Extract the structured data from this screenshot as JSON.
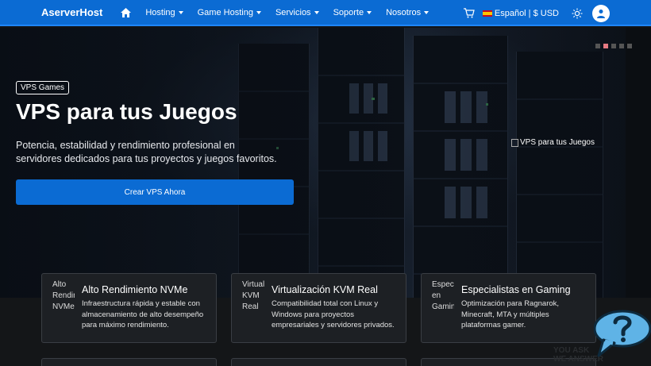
{
  "brand": "AserverHost",
  "nav": {
    "items": [
      {
        "label": "Hosting"
      },
      {
        "label": "Game Hosting"
      },
      {
        "label": "Servicios"
      },
      {
        "label": "Soporte"
      },
      {
        "label": "Nosotros"
      }
    ],
    "lang_label": "Español | $ USD",
    "icons": [
      "home-icon",
      "cart-icon",
      "spain-flag-icon",
      "sun-icon",
      "user-icon"
    ]
  },
  "hero": {
    "badge": "VPS Games",
    "title": "VPS para tus Juegos",
    "subtitle": "Potencia, estabilidad y rendimiento profesional en servidores dedicados para tus proyectos y juegos favoritos.",
    "cta_label": "Crear VPS Ahora",
    "image_alt": "VPS para tus Juegos",
    "slides": 5,
    "active_slide": 2
  },
  "features": [
    {
      "img_alt": "Alto Rendimiento NVMe",
      "title": "Alto Rendimiento NVMe",
      "description": "Infraestructura rápida y estable con almacenamiento de alto desempeño para máximo rendimiento."
    },
    {
      "img_alt": "Virtualización KVM Real",
      "title": "Virtualización KVM Real",
      "description": "Compatibilidad total con Linux y Windows para proyectos empresariales y servidores privados."
    },
    {
      "img_alt": "Especialistas en Gaming",
      "title": "Especialistas en Gaming",
      "description": "Optimización para Ragnarok, Minecraft, MTA y múltiples plataformas gamer."
    }
  ],
  "help": {
    "caption_line1": "YOU ASK",
    "caption_line2": "WE ANSWER"
  },
  "colors": {
    "primary": "#0b6bd3",
    "card_bg": "#1d2024",
    "active_dot": "#e57a82",
    "help_bubble": "#5fb3e6"
  }
}
